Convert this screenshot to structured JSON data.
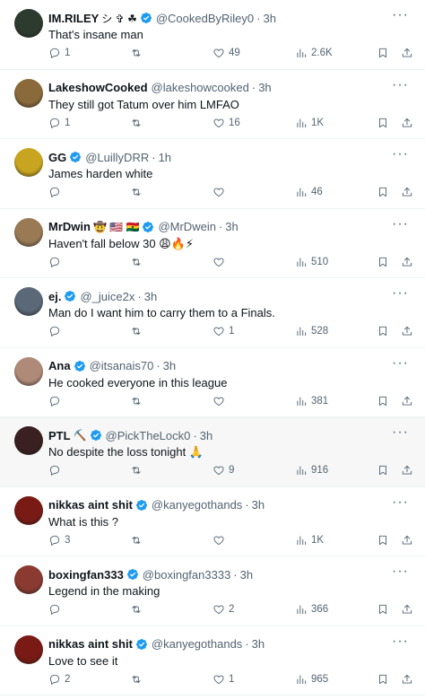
{
  "colors": {
    "verified": "#1d9bf0",
    "muted": "#536471",
    "text": "#0f1419",
    "highlight": "#f7f7f7"
  },
  "tweets": [
    {
      "name": "IM.RILEY",
      "symbols": "シ ✞ ☘",
      "verified": true,
      "handle": "@CookedByRiley0",
      "time": "3h",
      "text": "That's insane man",
      "replies": "1",
      "retweets": "",
      "likes": "49",
      "views": "2.6K",
      "avatar_color": "#2d3a2e",
      "highlight": false
    },
    {
      "name": "LakeshowCooked",
      "symbols": "",
      "verified": false,
      "handle": "@lakeshowcooked",
      "time": "3h",
      "text": "They still got Tatum over him LMFAO",
      "replies": "1",
      "retweets": "",
      "likes": "16",
      "views": "1K",
      "avatar_color": "#8a6a3a",
      "highlight": false
    },
    {
      "name": "GG",
      "symbols": "",
      "verified": true,
      "handle": "@LuillyDRR",
      "time": "1h",
      "text": "James harden white",
      "replies": "",
      "retweets": "",
      "likes": "",
      "views": "46",
      "avatar_color": "#c8a520",
      "highlight": false
    },
    {
      "name": "MrDwin",
      "symbols": "🤠 🇺🇸 🇬🇭",
      "verified": true,
      "handle": "@MrDwein",
      "time": "3h",
      "text": "Haven't fall below 30 😩🔥⚡",
      "replies": "",
      "retweets": "",
      "likes": "",
      "views": "510",
      "avatar_color": "#9a7a55",
      "highlight": false
    },
    {
      "name": "ej.",
      "symbols": "",
      "verified": true,
      "handle": "@_juice2x",
      "time": "3h",
      "text": "Man do I want him to carry them to a Finals.",
      "replies": "",
      "retweets": "",
      "likes": "1",
      "views": "528",
      "avatar_color": "#5a6878",
      "highlight": false
    },
    {
      "name": "Ana",
      "symbols": "",
      "verified": true,
      "handle": "@itsanais70",
      "time": "3h",
      "text": "He cooked everyone in this league",
      "replies": "",
      "retweets": "",
      "likes": "",
      "views": "381",
      "avatar_color": "#b08a78",
      "highlight": false
    },
    {
      "name": "PTL",
      "symbols": "⛏️",
      "verified": true,
      "handle": "@PickTheLock0",
      "time": "3h",
      "text": "No despite the loss tonight 🙏",
      "replies": "",
      "retweets": "",
      "likes": "9",
      "views": "916",
      "avatar_color": "#3a2020",
      "highlight": true
    },
    {
      "name": "nikkas aint shit",
      "symbols": "",
      "verified": true,
      "handle": "@kanyegothands",
      "time": "3h",
      "text": "What is this ?",
      "replies": "3",
      "retweets": "",
      "likes": "",
      "views": "1K",
      "avatar_color": "#7a1a14",
      "highlight": false
    },
    {
      "name": "boxingfan333",
      "symbols": "",
      "verified": true,
      "handle": "@boxingfan3333",
      "time": "3h",
      "text": "Legend in the making",
      "replies": "",
      "retweets": "",
      "likes": "2",
      "views": "366",
      "avatar_color": "#8a3a30",
      "highlight": false
    },
    {
      "name": "nikkas aint shit",
      "symbols": "",
      "verified": true,
      "handle": "@kanyegothands",
      "time": "3h",
      "text": "Love to see it",
      "replies": "2",
      "retweets": "",
      "likes": "1",
      "views": "965",
      "avatar_color": "#7a1a14",
      "highlight": false
    }
  ]
}
